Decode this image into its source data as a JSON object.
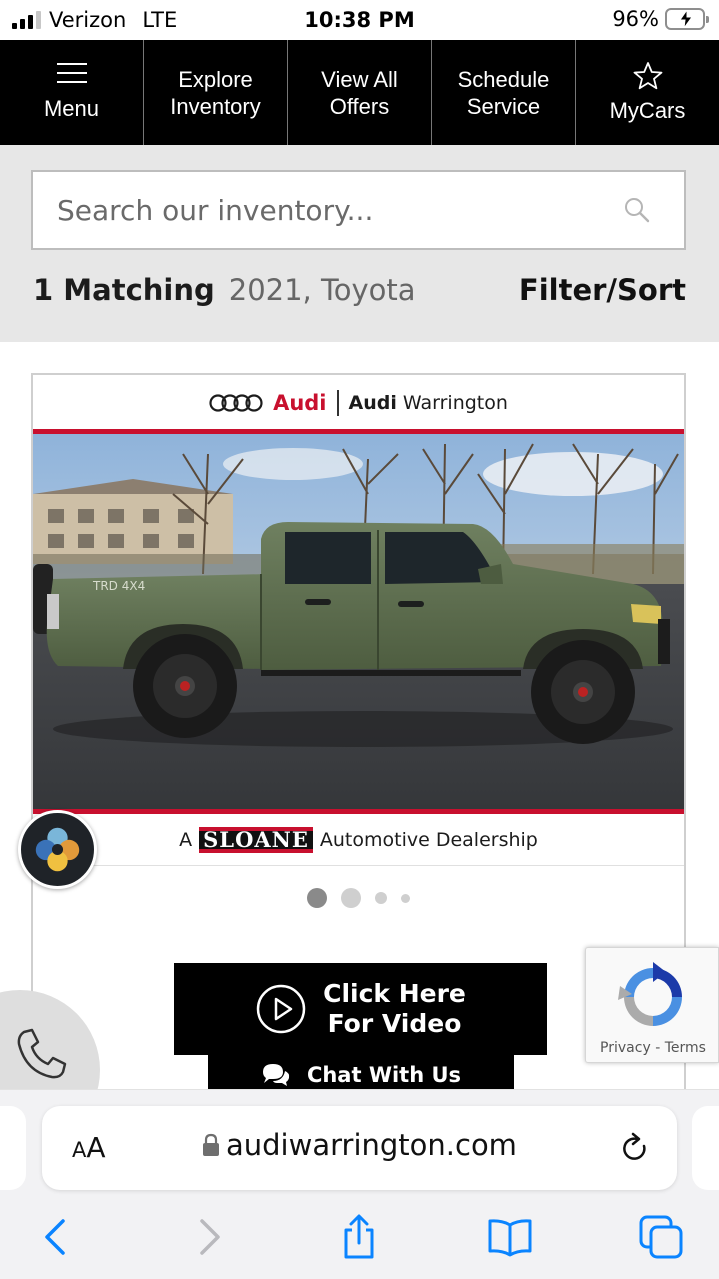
{
  "status_bar": {
    "carrier": "Verizon",
    "network": "LTE",
    "time": "10:38 PM",
    "battery": "96%",
    "battery_level": 0.96
  },
  "nav": {
    "items": [
      {
        "label": "Menu",
        "icon": "hamburger-icon"
      },
      {
        "label": "Explore\nInventory"
      },
      {
        "label": "View All\nOffers"
      },
      {
        "label": "Schedule\nService"
      },
      {
        "label": "MyCars",
        "icon": "star-icon"
      }
    ]
  },
  "search": {
    "placeholder": "Search our inventory...",
    "value": ""
  },
  "results": {
    "count": "1 Matching",
    "filters": "2021, Toyota",
    "filter_sort": "Filter/Sort"
  },
  "listing": {
    "brand": "Audi",
    "dealer_prefix": "Audi",
    "dealer_suffix": "Warrington",
    "photo_alt": "Green Toyota Tacoma TRD Pro pickup truck, side view",
    "badge_prefix": "A",
    "group_name": "SLOANE",
    "badge_suffix": "Automotive Dealership",
    "dots_total": 4,
    "dots_active": 1,
    "video_cta": "Click Here\nFor Video",
    "chat_cta": "Chat With Us"
  },
  "recaptcha": {
    "privacy": "Privacy",
    "separator": "-",
    "terms": "Terms"
  },
  "browser": {
    "aa_small": "A",
    "aa_big": "A",
    "url": "audiwarrington.com"
  },
  "colors": {
    "nav_bg": "#000000",
    "audi_red": "#c8102e",
    "truck_green": "#5a6b48",
    "ios_blue": "#0a84ff",
    "battery_green": "#34c759"
  }
}
